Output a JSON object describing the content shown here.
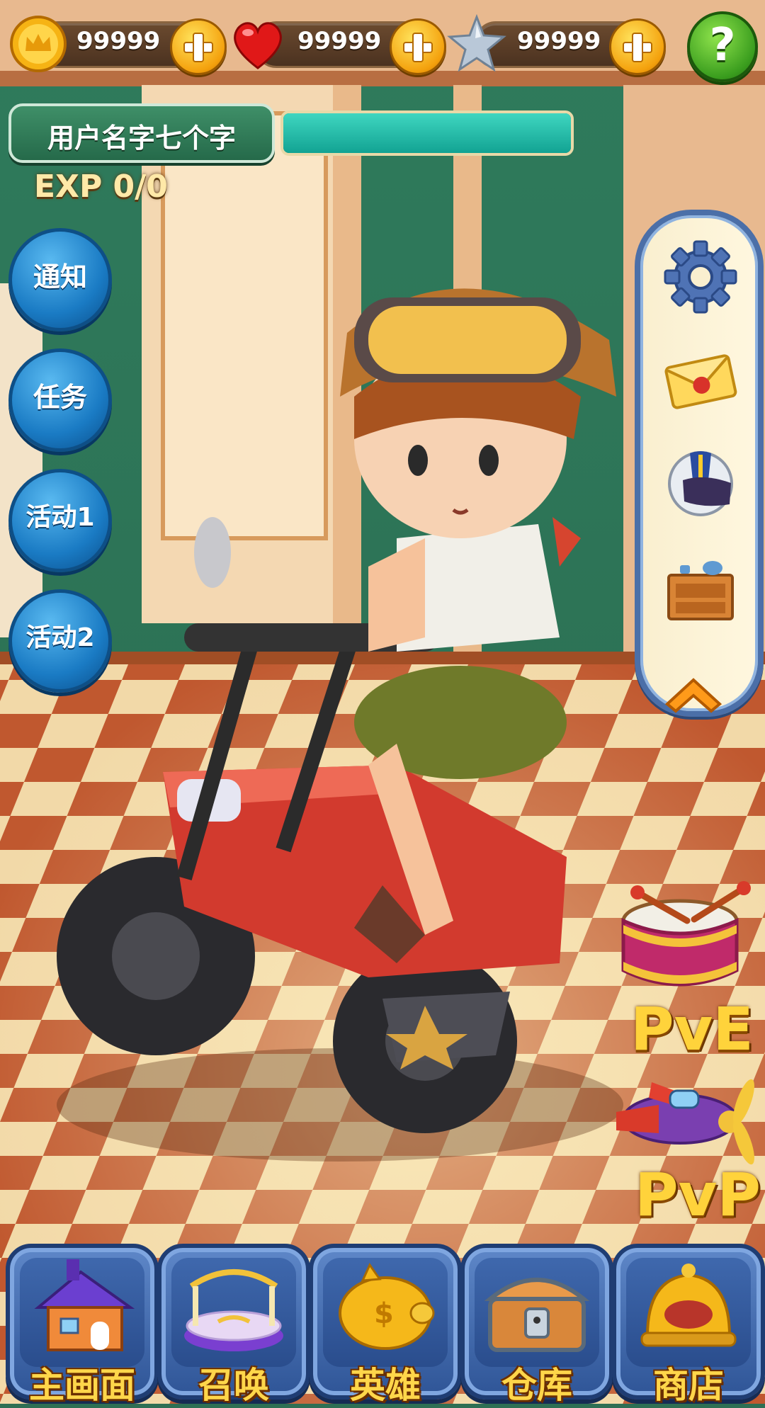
{
  "resources": [
    {
      "id": "coins",
      "value": "99999",
      "icon": "crown-coin-icon"
    },
    {
      "id": "hearts",
      "value": "99999",
      "icon": "heart-icon"
    },
    {
      "id": "stars",
      "value": "99999",
      "icon": "star-icon"
    }
  ],
  "help": {
    "label": "?"
  },
  "player": {
    "name": "用户名字七个字",
    "exp_label": "EXP 0/0",
    "exp_fill": 1.0
  },
  "left_menu": [
    "通知",
    "任务",
    "活动1",
    "活动2"
  ],
  "side_menu": [
    "gear-icon",
    "mail-icon",
    "helmet-icon",
    "furniture-icon"
  ],
  "modes": [
    {
      "label": "PvE",
      "icon": "drum-icon"
    },
    {
      "label": "PvP",
      "icon": "airplane-icon"
    }
  ],
  "bottom_nav": [
    "主画面",
    "召唤",
    "英雄",
    "仓库",
    "商店"
  ],
  "colors": {
    "accent": "#ffd64a",
    "panel_border": "#4b6fa8",
    "exp_fill": "#1fb7a6"
  }
}
